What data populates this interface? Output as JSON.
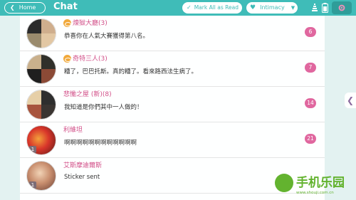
{
  "header": {
    "home_label": "Home",
    "title": "Chat",
    "mark_all_label": "Mark All as Read",
    "sort_label": "Intimacy",
    "accent_color": "#3fbcb8"
  },
  "chats": [
    {
      "name": "煉獄大廳(3)",
      "message": "恭喜你在人氣大賽獲得第八名。",
      "count": "6",
      "is_group": true,
      "has_eye_badge": true
    },
    {
      "name": "奇特三人(3)",
      "message": "糟了，巴巴托斯。真的糟了。看來路西法生病了。",
      "count": "7",
      "is_group": true,
      "has_eye_badge": true
    },
    {
      "name": "悲慟之屋 (新)(8)",
      "message": "我知道是你們其中一人做的！",
      "count": "14",
      "is_group": true,
      "has_eye_badge": false
    },
    {
      "name": "利維坦",
      "message": "啊啊啊啊啊啊啊啊啊啊啊啊",
      "count": "21",
      "is_group": false,
      "level": "1"
    },
    {
      "name": "艾斯摩迪爾斯",
      "message": "Sticker sent",
      "count": "",
      "is_group": false,
      "level": "1"
    }
  ],
  "watermark": {
    "text": "手机乐园",
    "url": "www.shouji.com.cn"
  },
  "colors": {
    "name": "#d24f88",
    "badge": "#e0679f",
    "eye_badge": "#f1a93b"
  },
  "icons": {
    "home": "chevron-left-icon",
    "mark_all": "checkmark-icon",
    "sort": "heart-icon",
    "settings": "gear-icon",
    "side": "chevron-left-icon"
  }
}
